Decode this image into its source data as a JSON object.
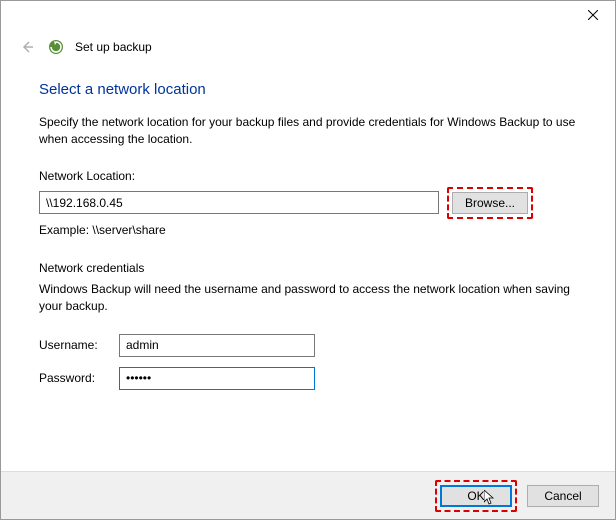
{
  "window": {
    "wizard_title": "Set up backup"
  },
  "page": {
    "heading": "Select a network location",
    "description": "Specify the network location for your backup files and provide credentials for Windows Backup to use when accessing the location.",
    "network_location_label": "Network Location:",
    "network_location_value": "\\\\192.168.0.45",
    "browse_label": "Browse...",
    "example_text": "Example: \\\\server\\share",
    "credentials_section_label": "Network credentials",
    "credentials_description": "Windows Backup will need the username and password to access the network location when saving your backup.",
    "username_label": "Username:",
    "username_value": "admin",
    "password_label": "Password:",
    "password_value": "••••••"
  },
  "footer": {
    "ok_label": "OK",
    "cancel_label": "Cancel"
  }
}
